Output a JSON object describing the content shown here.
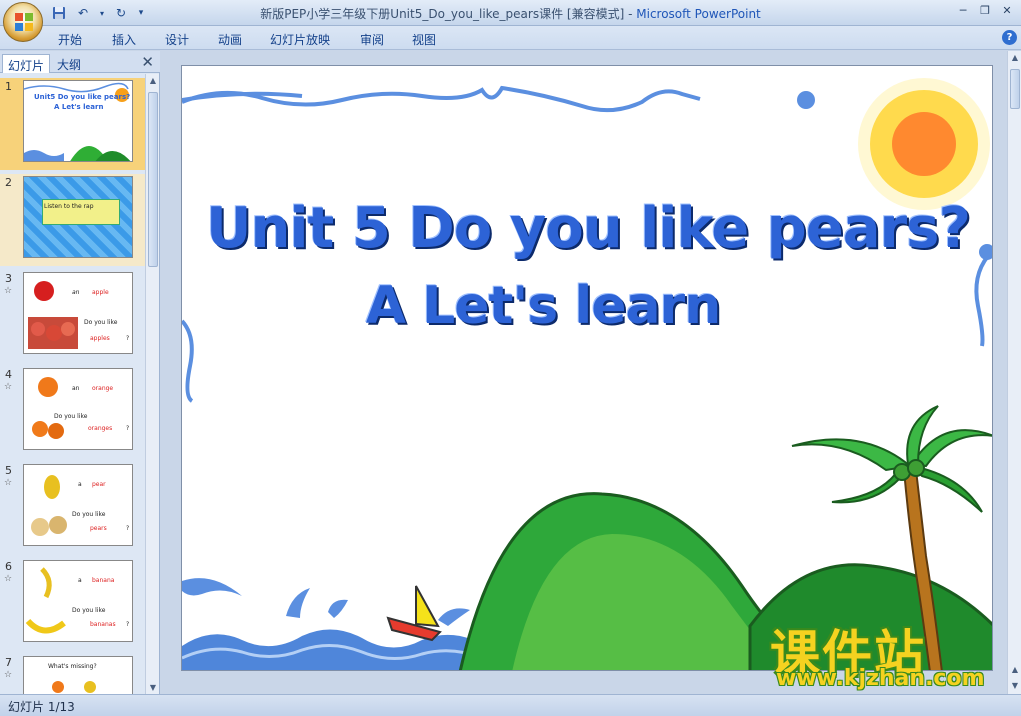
{
  "window": {
    "title": "新版PEP小学三年级下册Unit5_Do_you_like_pears课件 [兼容模式]",
    "app_separator": " - ",
    "app_name": "Microsoft PowerPoint"
  },
  "menu": [
    "开始",
    "插入",
    "设计",
    "动画",
    "幻灯片放映",
    "审阅",
    "视图"
  ],
  "panel": {
    "tab_slides": "幻灯片",
    "tab_outline": "大纲"
  },
  "thumbnails": [
    {
      "num": "1",
      "t1": "Unit5 Do you like pears?",
      "t2": "A Let's learn"
    },
    {
      "num": "2",
      "t1": "Listen to the rap"
    },
    {
      "num": "3",
      "a": "an",
      "word": "apple",
      "q": "Do you like",
      "plural": "apples",
      "qm": "?"
    },
    {
      "num": "4",
      "a": "an",
      "word": "orange",
      "q": "Do you like",
      "plural": "oranges",
      "qm": "?"
    },
    {
      "num": "5",
      "a": "a",
      "word": "pear",
      "q": "Do you like",
      "plural": "pears",
      "qm": "?"
    },
    {
      "num": "6",
      "a": "a",
      "word": "banana",
      "q": "Do you like",
      "plural": "bananas",
      "qm": "?"
    },
    {
      "num": "7",
      "q": "What's missing?"
    }
  ],
  "slide": {
    "title_line1": "Unit 5 Do you like pears?",
    "title_line2": "A  Let's learn"
  },
  "watermark": {
    "cn": "课件站",
    "url": "www.kjzhan.com"
  },
  "status": {
    "slide_counter": "幻灯片 1/13"
  }
}
